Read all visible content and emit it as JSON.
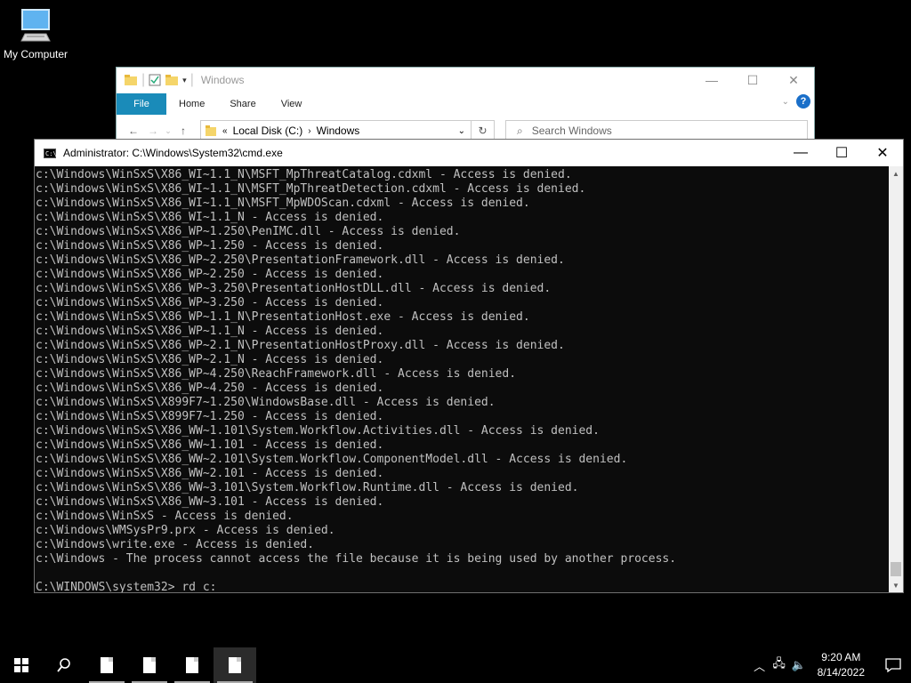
{
  "desktop": {
    "icon_label": "My Computer"
  },
  "explorer": {
    "title": "Windows",
    "ribbon_tabs": [
      "File",
      "Home",
      "Share",
      "View"
    ],
    "address_parts": [
      "Local Disk (C:)",
      "Windows"
    ],
    "search_placeholder": "Search Windows"
  },
  "cmd": {
    "title": "Administrator: C:\\Windows\\System32\\cmd.exe",
    "lines": [
      "c:\\Windows\\WinSxS\\X86_WI~1.1_N\\MSFT_MpThreatCatalog.cdxml - Access is denied.",
      "c:\\Windows\\WinSxS\\X86_WI~1.1_N\\MSFT_MpThreatDetection.cdxml - Access is denied.",
      "c:\\Windows\\WinSxS\\X86_WI~1.1_N\\MSFT_MpWDOScan.cdxml - Access is denied.",
      "c:\\Windows\\WinSxS\\X86_WI~1.1_N - Access is denied.",
      "c:\\Windows\\WinSxS\\X86_WP~1.250\\PenIMC.dll - Access is denied.",
      "c:\\Windows\\WinSxS\\X86_WP~1.250 - Access is denied.",
      "c:\\Windows\\WinSxS\\X86_WP~2.250\\PresentationFramework.dll - Access is denied.",
      "c:\\Windows\\WinSxS\\X86_WP~2.250 - Access is denied.",
      "c:\\Windows\\WinSxS\\X86_WP~3.250\\PresentationHostDLL.dll - Access is denied.",
      "c:\\Windows\\WinSxS\\X86_WP~3.250 - Access is denied.",
      "c:\\Windows\\WinSxS\\X86_WP~1.1_N\\PresentationHost.exe - Access is denied.",
      "c:\\Windows\\WinSxS\\X86_WP~1.1_N - Access is denied.",
      "c:\\Windows\\WinSxS\\X86_WP~2.1_N\\PresentationHostProxy.dll - Access is denied.",
      "c:\\Windows\\WinSxS\\X86_WP~2.1_N - Access is denied.",
      "c:\\Windows\\WinSxS\\X86_WP~4.250\\ReachFramework.dll - Access is denied.",
      "c:\\Windows\\WinSxS\\X86_WP~4.250 - Access is denied.",
      "c:\\Windows\\WinSxS\\X899F7~1.250\\WindowsBase.dll - Access is denied.",
      "c:\\Windows\\WinSxS\\X899F7~1.250 - Access is denied.",
      "c:\\Windows\\WinSxS\\X86_WW~1.101\\System.Workflow.Activities.dll - Access is denied.",
      "c:\\Windows\\WinSxS\\X86_WW~1.101 - Access is denied.",
      "c:\\Windows\\WinSxS\\X86_WW~2.101\\System.Workflow.ComponentModel.dll - Access is denied.",
      "c:\\Windows\\WinSxS\\X86_WW~2.101 - Access is denied.",
      "c:\\Windows\\WinSxS\\X86_WW~3.101\\System.Workflow.Runtime.dll - Access is denied.",
      "c:\\Windows\\WinSxS\\X86_WW~3.101 - Access is denied.",
      "c:\\Windows\\WinSxS - Access is denied.",
      "c:\\Windows\\WMSysPr9.prx - Access is denied.",
      "c:\\Windows\\write.exe - Access is denied.",
      "c:\\Windows - The process cannot access the file because it is being used by another process.",
      "",
      "C:\\WINDOWS\\system32> rd c:"
    ]
  },
  "taskbar": {
    "time": "9:20 AM",
    "date": "8/14/2022"
  },
  "colors": {
    "accent": "#1a8bb9",
    "console_bg": "#0c0c0c",
    "console_text": "#c0c0c0"
  }
}
